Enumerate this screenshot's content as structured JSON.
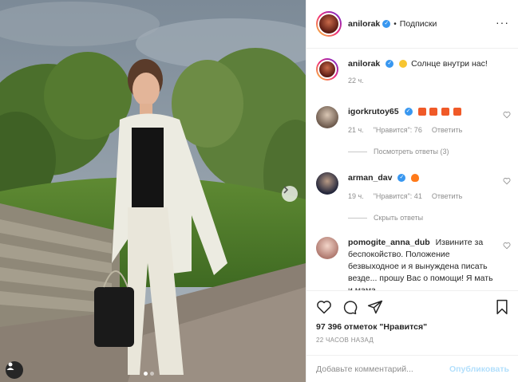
{
  "post": {
    "author": "anilorak",
    "follow_label": "Подписки",
    "caption_text": "Солнце внутри нас!",
    "caption_time": "22 ч."
  },
  "comments": [
    {
      "user": "igorkrutoy65",
      "text": "",
      "emoji": [
        "collision-emoji",
        "collision-emoji",
        "collision-emoji",
        "collision-emoji"
      ],
      "time": "21 ч.",
      "likes": "\"Нравится\": 76",
      "reply": "Ответить",
      "view_replies": "Посмотреть ответы (3)"
    },
    {
      "user": "arman_dav",
      "text": "",
      "emoji": [
        "fire-emoji"
      ],
      "time": "19 ч.",
      "likes": "\"Нравится\": 41",
      "reply": "Ответить",
      "hide_replies": "Скрыть ответы"
    },
    {
      "user": "pomogite_anna_dub",
      "text": "Извините за беспокойство. Положение безвыходное и я вынуждена писать везде... прошу Вас о помощи! Я мать и мама"
    }
  ],
  "likes": {
    "count": "97 396 отметок",
    "suffix": "\"Нравится\""
  },
  "timestamp": "22 ЧАСОВ НАЗАД",
  "add_comment": {
    "placeholder": "Добавьте комментарий...",
    "publish": "Опубликовать"
  },
  "colors": {
    "verified": "#3897f0",
    "publish_disabled": "#b2dffc",
    "meta_text": "#8e8e8e"
  }
}
